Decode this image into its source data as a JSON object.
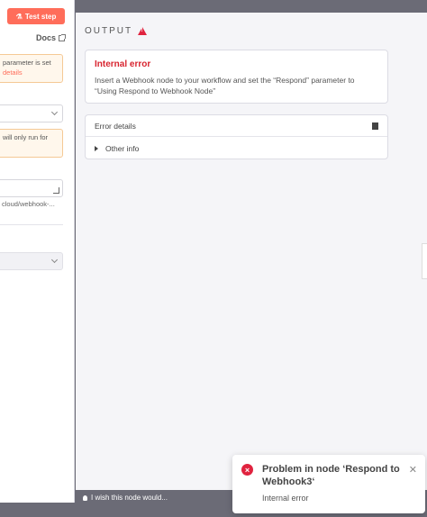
{
  "left_panel": {
    "test_step_label": "Test step",
    "docs_label": "Docs",
    "warning1_text_a": "parameter is set",
    "warning1_link": "details",
    "warning2_text_a": "will only run for",
    "url_text": "cloud/webhook-..."
  },
  "output": {
    "header": "OUTPUT",
    "error_title": "Internal error",
    "error_message": "Insert a Webhook node to your workflow and set the “Respond” parameter to “Using Respond to Webhook Node”",
    "details_label": "Error details",
    "other_info_label": "Other info"
  },
  "bottom": {
    "wish_text": "I wish this node would..."
  },
  "toast": {
    "title": "Problem in node ‘Respond to Webhook3‘",
    "message": "Internal error"
  },
  "colors": {
    "accent": "#ff6d5a",
    "error": "#e0233f"
  }
}
